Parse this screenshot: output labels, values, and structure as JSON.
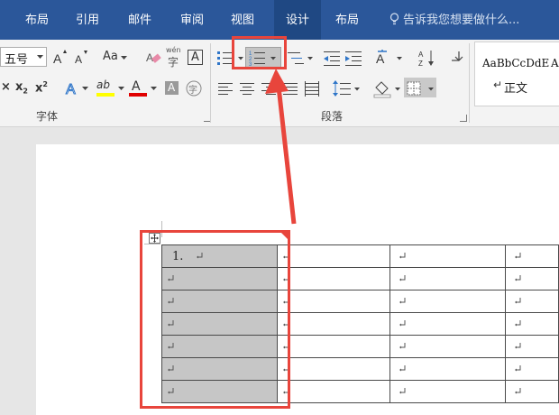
{
  "tabs": [
    {
      "label": "布局",
      "active": false
    },
    {
      "label": "引用",
      "active": false
    },
    {
      "label": "邮件",
      "active": false
    },
    {
      "label": "审阅",
      "active": false
    },
    {
      "label": "视图",
      "active": false
    },
    {
      "label": "设计",
      "active": true
    },
    {
      "label": "布局",
      "active": false
    }
  ],
  "tell_me": "告诉我您想要做什么...",
  "font_group": {
    "label": "字体",
    "font_size": "五号",
    "change_case": "Aa",
    "phonetic_guide": "wén",
    "enclosed_char": "字",
    "font_color_letter": "A",
    "shade_letter": "A",
    "border_letter": "A",
    "highlight_letters": "ab"
  },
  "paragraph_group": {
    "label": "段落"
  },
  "styles_group": {
    "sample": "AaBbCcDdE",
    "sample2": "A",
    "style_name": "正文"
  },
  "table": {
    "first_cell_text": "1.",
    "rows": 7,
    "cols": 4
  },
  "colors": {
    "tab_bar": "#2b579a",
    "active_tab": "#1f4883",
    "ribbon": "#f3f3f3",
    "highlight_box": "#e8453c",
    "cell_shade": "#c6c6c6",
    "highlight_yellow": "#ffff00",
    "font_color_red": "#e00000"
  }
}
